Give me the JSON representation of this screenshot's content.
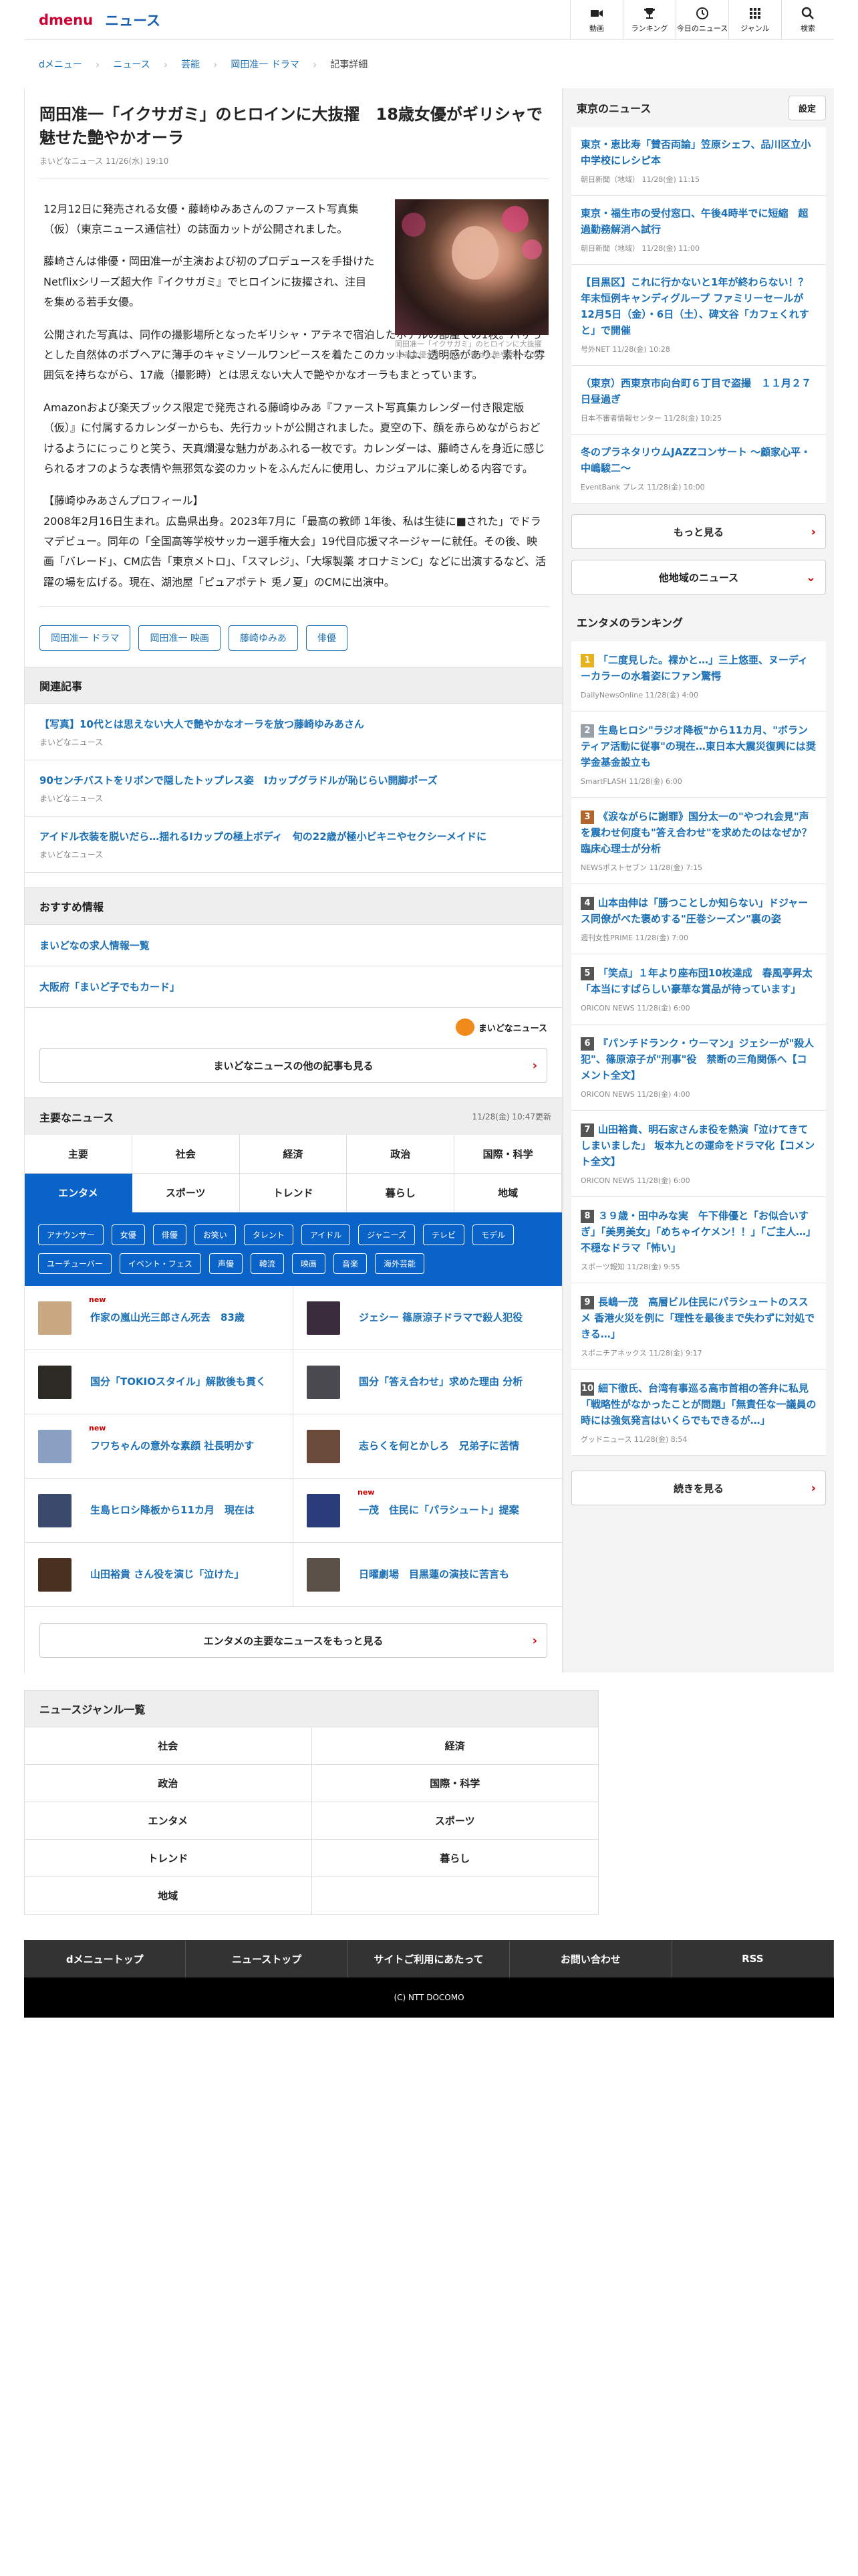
{
  "header": {
    "logo_d": "d",
    "logo_menu": "menu",
    "logo_news": "ニュース",
    "nav": [
      "動画",
      "ランキング",
      "今日のニュース",
      "ジャンル",
      "検索"
    ]
  },
  "breadcrumb": [
    "dメニュー",
    "ニュース",
    "芸能",
    "岡田准一 ドラマ",
    "記事詳細"
  ],
  "article": {
    "title": "岡田准一「イクサガミ」のヒロインに大抜擢　18歳女優がギリシャで魅せた艶やかオーラ",
    "meta": "まいどなニュース 11/26(水) 19:10",
    "photo_caption": "岡田准一「イクサガミ」のヒロインに大抜擢　18歳女優がギリシャで魅せた艶やかオーラ",
    "paragraphs": [
      "12月12日に発売される女優・藤崎ゆみあさんのファースト写真集（仮）（東京ニュース通信社）の誌面カットが公開されました。",
      "藤崎さんは俳優・岡田准一が主演および初のプロデュースを手掛けたNetflixシリーズ超大作『イクサガミ』でヒロインに抜擢され、注目を集める若手女優。",
      "公開された写真は、同作の撮影場所となったギリシャ・アテネで宿泊したホテルの部屋での1枚。バサっとした自然体のボブヘアに薄手のキャミソールワンピースを着たこのカットは、透明感があり、素朴な雰囲気を持ちながら、17歳（撮影時）とは思えない大人で艶やかなオーラもまとっています。",
      "Amazonおよび楽天ブックス限定で発売される藤崎ゆみあ『ファースト写真集カレンダー付き限定版（仮）』に付属するカレンダーからも、先行カットが公開されました。夏空の下、顔を赤らめながらおどけるようににっこりと笑う、天真爛漫な魅力があふれる一枚です。カレンダーは、藤崎さんを身近に感じられるオフのような表情や無邪気な姿のカットをふんだんに使用し、カジュアルに楽しめる内容です。",
      "【藤崎ゆみあさんプロフィール】\n2008年2月16日生まれ。広島県出身。2023年7月に「最高の教師 1年後、私は生徒に■された」でドラマデビュー。同年の「全国高等学校サッカー選手権大会」19代目応援マネージャーに就任。その後、映画「バレード」、CM広告「東京メトロ」、「スマレジ」、「大塚製薬 オロナミンC」などに出演するなど、活躍の場を広げる。現在、湖池屋「ピュアポテト 兎ノ夏」のCMに出演中。"
    ],
    "tags": [
      "岡田准一 ドラマ",
      "岡田准一 映画",
      "藤崎ゆみあ",
      "俳優"
    ]
  },
  "related": {
    "heading": "関連記事",
    "items": [
      {
        "t": "【写真】10代とは思えない大人で艶やかなオーラを放つ藤崎ゆみあさん",
        "s": "まいどなニュース"
      },
      {
        "t": "90センチバストをリボンで隠したトップレス姿　Iカップグラドルが恥じらい開脚ポーズ",
        "s": "まいどなニュース"
      },
      {
        "t": "アイドル衣装を脱いだら…揺れるIカップの極上ボディ　旬の22歳が極小ビキニやセクシーメイドに",
        "s": "まいどなニュース"
      }
    ]
  },
  "recommend": {
    "heading": "おすすめ情報",
    "items": [
      "まいどなの求人情報一覧",
      "大阪府「まいど子でもカード」"
    ],
    "logo_text": "まいどなニュース",
    "more": "まいどなニュースの他の記事も見る"
  },
  "main_news": {
    "heading": "主要なニュース",
    "updated": "11/28(金) 10:47更新",
    "tabs": [
      "主要",
      "社会",
      "経済",
      "政治",
      "国際・科学",
      "エンタメ",
      "スポーツ",
      "トレンド",
      "暮らし",
      "地域"
    ],
    "chips": [
      "アナウンサー",
      "女優",
      "俳優",
      "お笑い",
      "タレント",
      "アイドル",
      "ジャニーズ",
      "テレビ",
      "モデル",
      "ユーチューバー",
      "イベント・フェス",
      "声優",
      "韓流",
      "映画",
      "音楽",
      "海外芸能"
    ],
    "items": [
      {
        "t": "作家の嵐山光三郎さん死去　83歳",
        "new": "new",
        "c": "#c9a982"
      },
      {
        "t": "ジェシー 篠原涼子ドラマで殺人犯役",
        "new": "",
        "c": "#3a2c3c"
      },
      {
        "t": "国分「TOKIOスタイル」解散後も貫く",
        "new": "",
        "c": "#2c2a24"
      },
      {
        "t": "国分「答え合わせ」求めた理由 分析",
        "new": "",
        "c": "#4a4a50"
      },
      {
        "t": "フワちゃんの意外な素顔 社長明かす",
        "new": "new",
        "c": "#8aa0c2"
      },
      {
        "t": "志らくを何とかしろ　兄弟子に苦情",
        "new": "",
        "c": "#6a4a3a"
      },
      {
        "t": "生島ヒロシ降板から11カ月　現在は",
        "new": "",
        "c": "#3a4a6c"
      },
      {
        "t": "一茂　住民に「パラシュート」提案",
        "new": "new",
        "c": "#2a3c7a"
      },
      {
        "t": "山田裕貴 さん役を演じ「泣けた」",
        "new": "",
        "c": "#4a3020"
      },
      {
        "t": "日曜劇場　目黒蓮の演技に苦言も",
        "new": "",
        "c": "#5a5048"
      }
    ],
    "more": "エンタメの主要なニュースをもっと見る"
  },
  "genre": {
    "heading": "ニュースジャンル一覧",
    "items": [
      "社会",
      "経済",
      "政治",
      "国際・科学",
      "エンタメ",
      "スポーツ",
      "トレンド",
      "暮らし",
      "地域",
      ""
    ]
  },
  "footer": {
    "links": [
      "dメニュートップ",
      "ニューストップ",
      "サイトご利用にあたって",
      "お問い合わせ",
      "RSS"
    ],
    "copy": "(C) NTT DOCOMO"
  },
  "sidebar": {
    "local_heading": "東京のニュース",
    "settings": "設定",
    "local": [
      {
        "t": "東京・恵比寿「賛否両論」笠原シェフ、品川区立小中学校にレシピ本",
        "s": "朝日新聞（地域） 11/28(金) 11:15"
      },
      {
        "t": "東京・福生市の受付窓口、午後4時半でに短縮　超過勤務解消へ試行",
        "s": "朝日新聞（地域） 11/28(金) 11:00"
      },
      {
        "t": "【目黒区】これに行かないと1年が終わらない！？年末恒例キャンディグループ ファミリーセールが12月5日（金）・6日（土）、碑文谷「カフェくれすと」で開催",
        "s": "号外NET 11/28(金) 10:28"
      },
      {
        "t": "（東京）西東京市向台町６丁目で盗撮　１１月２７日昼過ぎ",
        "s": "日本不審者情報センター 11/28(金) 10:25"
      },
      {
        "t": "冬のプラネタリウムJAZZコンサート 〜顧家心平・中嶋駿二〜",
        "s": "EventBank プレス 11/28(金) 10:00"
      }
    ],
    "more": "もっと見る",
    "other": "他地域のニュース",
    "rank_heading": "エンタメのランキング",
    "ranks": [
      {
        "n": "1",
        "c": "#e8b21c",
        "t": "「二度見した。裸かと…」三上悠亜、ヌーディーカラーの水着姿にファン驚愕",
        "s": "DailyNewsOnline 11/28(金) 4:00"
      },
      {
        "n": "2",
        "c": "#9aa0a8",
        "t": "生島ヒロシ\"ラジオ降板\"から11カ月、\"ボランティア活動に従事\"の現在…東日本大震災復興には奨学金基金設立も",
        "s": "SmartFLASH 11/28(金) 6:00"
      },
      {
        "n": "3",
        "c": "#b2652c",
        "t": "《涙ながらに謝罪》国分太一の\"やつれ会見\"声を震わせ何度も\"答え合わせ\"を求めたのはなぜか？臨床心理士が分析",
        "s": "NEWSポストセブン 11/28(金) 7:15"
      },
      {
        "n": "4",
        "c": "#555",
        "t": "山本由伸は「勝つことしか知らない」ドジャース同僚がべた褒めする\"圧巻シーズン\"裏の姿",
        "s": "週刊女性PRIME 11/28(金) 7:00"
      },
      {
        "n": "5",
        "c": "#555",
        "t": "「笑点」１年より座布団10枚達成　春風亭昇太「本当にすばらしい豪華な賞品が待っています」",
        "s": "ORICON NEWS 11/28(金) 6:00"
      },
      {
        "n": "6",
        "c": "#555",
        "t": "『パンチドランク・ウーマン』ジェシーが\"殺人犯\"、篠原涼子が\"刑事\"役　禁断の三角関係へ【コメント全文】",
        "s": "ORICON NEWS 11/28(金) 4:00"
      },
      {
        "n": "7",
        "c": "#555",
        "t": "山田裕貴、明石家さんま役を熱演「泣けてきてしまいました」 坂本九との運命をドラマ化【コメント全文】",
        "s": "ORICON NEWS 11/28(金) 6:00"
      },
      {
        "n": "8",
        "c": "#555",
        "t": "３９歳・田中みな実　午下俳優と「お似合いすぎ」「美男美女」「めちゃイケメン！！」「ご主人…」不穏なドラマ「怖い」",
        "s": "スポーツ報知 11/28(金) 9:55"
      },
      {
        "n": "9",
        "c": "#555",
        "t": "長嶋一茂　高層ビル住民にパラシュートのススメ 香港火災を例に「理性を最後まで失わずに対処できる…」",
        "s": "スポニチアネックス 11/28(金) 9:17"
      },
      {
        "n": "10",
        "c": "#555",
        "t": "細下徹氏、台湾有事巡る高市首相の答弁に私見「戦略性がなかったことが問題」「無責任な一議員の時には強気発言はいくらでもできるが…」",
        "s": "グッドニュース 11/28(金) 8:54"
      }
    ],
    "rank_more": "続きを見る"
  }
}
